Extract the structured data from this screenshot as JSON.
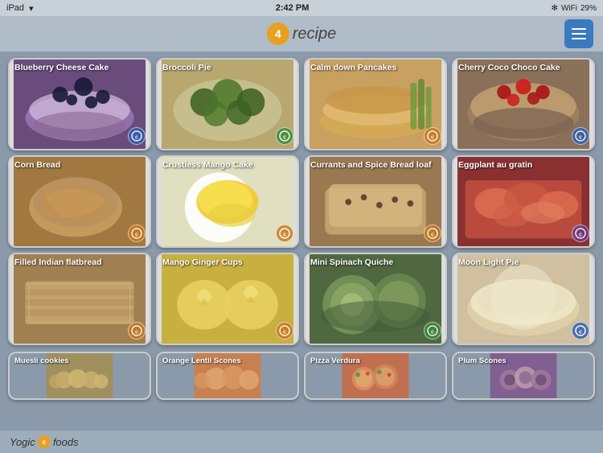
{
  "statusBar": {
    "left": "iPad",
    "time": "2:42 PM",
    "wifi": "wifi",
    "bluetooth": "BT",
    "battery": "29%"
  },
  "header": {
    "logoText": "recipe",
    "menuLabel": "menu"
  },
  "recipes": [
    {
      "id": 1,
      "title": "Blueberry Cheese Cake",
      "bgClass": "bg-blueberry",
      "badgeClass": "badge-blue",
      "badgeText": "c"
    },
    {
      "id": 2,
      "title": "Broccoli Pie",
      "bgClass": "bg-broccoli",
      "badgeClass": "badge-green",
      "badgeText": "c"
    },
    {
      "id": 3,
      "title": "Calm down Pancakes",
      "bgClass": "bg-pancakes",
      "badgeClass": "badge-orange",
      "badgeText": "c"
    },
    {
      "id": 4,
      "title": "Cherry Coco Choco Cake",
      "bgClass": "bg-cherry",
      "badgeClass": "badge-blue",
      "badgeText": "c"
    },
    {
      "id": 5,
      "title": "Corn Bread",
      "bgClass": "bg-cornbread",
      "badgeClass": "badge-orange",
      "badgeText": "c"
    },
    {
      "id": 6,
      "title": "Crustless Mango Cake",
      "bgClass": "bg-mango",
      "badgeClass": "badge-orange",
      "badgeText": "c"
    },
    {
      "id": 7,
      "title": "Currants and Spice Bread loaf",
      "bgClass": "bg-currants",
      "badgeClass": "badge-orange",
      "badgeText": "c"
    },
    {
      "id": 8,
      "title": "Eggplant au gratin",
      "bgClass": "bg-eggplant",
      "badgeClass": "badge-purple",
      "badgeText": "c"
    },
    {
      "id": 9,
      "title": "Filled Indian flatbread",
      "bgClass": "bg-flatbread",
      "badgeClass": "badge-orange",
      "badgeText": "c"
    },
    {
      "id": 10,
      "title": "Mango Ginger Cups",
      "bgClass": "bg-gingercups",
      "badgeClass": "badge-orange",
      "badgeText": "c"
    },
    {
      "id": 11,
      "title": "Mini Spinach Quiche",
      "bgClass": "bg-spinach",
      "badgeClass": "badge-green",
      "badgeText": "c"
    },
    {
      "id": 12,
      "title": "Moon Light Pie",
      "bgClass": "bg-moonpie",
      "badgeClass": "badge-blue",
      "badgeText": "c"
    },
    {
      "id": 13,
      "title": "Muesli cookies",
      "bgClass": "bg-muesli",
      "badgeClass": "badge-orange",
      "badgeText": "c"
    },
    {
      "id": 14,
      "title": "Orange Lentil Scones",
      "bgClass": "bg-lentil",
      "badgeClass": "badge-orange",
      "badgeText": "c"
    },
    {
      "id": 15,
      "title": "Pizza Verdura",
      "bgClass": "bg-pizza",
      "badgeClass": "badge-orange",
      "badgeText": "c"
    },
    {
      "id": 16,
      "title": "Plum Scones",
      "bgClass": "bg-plum",
      "badgeClass": "badge-purple",
      "badgeText": "c"
    }
  ],
  "bottomLogo": {
    "text": "Yogic",
    "suffix": "foods"
  }
}
